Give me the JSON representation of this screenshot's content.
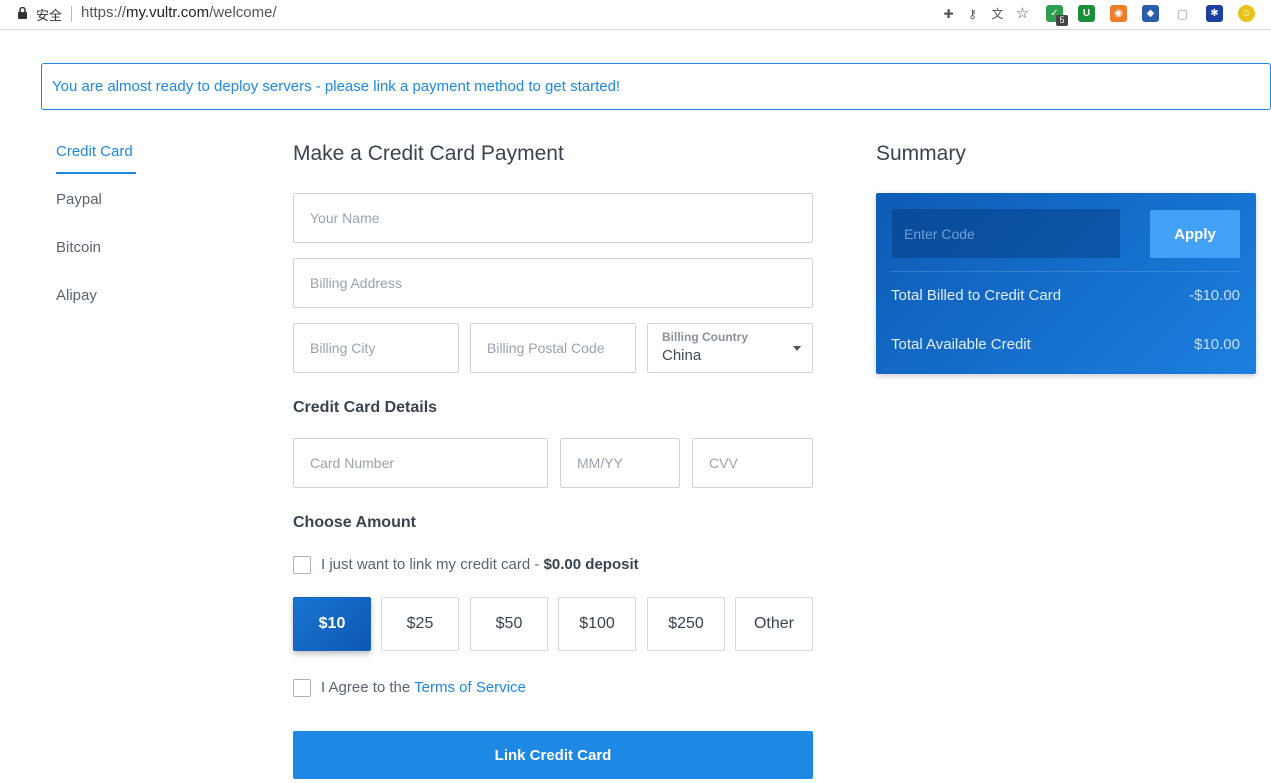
{
  "browser": {
    "secure_label": "安全",
    "url_scheme": "https://",
    "url_host": "my.vultr.com",
    "url_path": "/welcome/",
    "extension_badge": "5"
  },
  "notice": {
    "text": "You are almost ready to deploy servers - please link a payment method to get started!"
  },
  "tabs": [
    {
      "label": "Credit Card",
      "active": true
    },
    {
      "label": "Paypal",
      "active": false
    },
    {
      "label": "Bitcoin",
      "active": false
    },
    {
      "label": "Alipay",
      "active": false
    }
  ],
  "form": {
    "title": "Make a Credit Card Payment",
    "name_placeholder": "Your Name",
    "address_placeholder": "Billing Address",
    "city_placeholder": "Billing City",
    "postal_placeholder": "Billing Postal Code",
    "country_label": "Billing Country",
    "country_value": "China",
    "card_section_title": "Credit Card Details",
    "card_number_placeholder": "Card Number",
    "expiry_placeholder": "MM/YY",
    "cvv_placeholder": "CVV",
    "amount_section_title": "Choose Amount",
    "link_only_text": "I just want to link my credit card - ",
    "link_only_bold": "$0.00 deposit",
    "amounts": [
      {
        "label": "$10",
        "selected": true
      },
      {
        "label": "$25",
        "selected": false
      },
      {
        "label": "$50",
        "selected": false
      },
      {
        "label": "$100",
        "selected": false
      },
      {
        "label": "$250",
        "selected": false
      },
      {
        "label": "Other",
        "selected": false
      }
    ],
    "agree_text": "I Agree to the ",
    "tos_link": "Terms of Service",
    "submit_label": "Link Credit Card"
  },
  "summary": {
    "title": "Summary",
    "code_placeholder": "Enter Code",
    "apply_label": "Apply",
    "rows": [
      {
        "label": "Total Billed to Credit Card",
        "value": "-$10.00"
      },
      {
        "label": "Total Available Credit",
        "value": "$10.00"
      }
    ]
  },
  "colors": {
    "accent": "#1e88e5",
    "summary_card": "#1565c0"
  }
}
